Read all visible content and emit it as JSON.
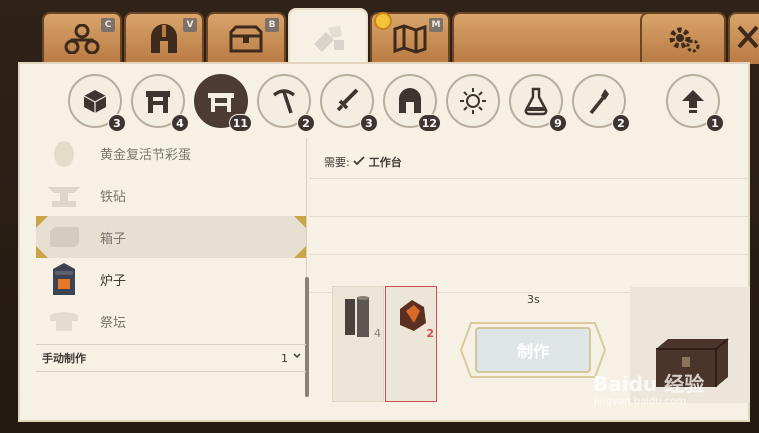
{
  "tabs": [
    {
      "key": "C",
      "icon": "skills-tree-icon"
    },
    {
      "key": "V",
      "icon": "helmet-icon"
    },
    {
      "key": "B",
      "icon": "chest-icon"
    },
    {
      "key": "",
      "icon": "crafting-icon"
    },
    {
      "key": "M",
      "icon": "map-icon"
    }
  ],
  "categories": [
    {
      "icon": "block-icon",
      "count": "3"
    },
    {
      "icon": "furnace-icon",
      "count": "4"
    },
    {
      "icon": "workbench-icon",
      "count": "11"
    },
    {
      "icon": "pickaxe-icon",
      "count": "2"
    },
    {
      "icon": "sword-icon",
      "count": "3"
    },
    {
      "icon": "helmet-icon",
      "count": "12"
    },
    {
      "icon": "sparkle-icon",
      "count": ""
    },
    {
      "icon": "potion-icon",
      "count": "9"
    },
    {
      "icon": "torch-icon",
      "count": "2"
    },
    {
      "icon": "upgrade-arrow-icon",
      "count": "1"
    }
  ],
  "recipes": [
    {
      "name": "黄金复活节彩蛋"
    },
    {
      "name": "铁砧"
    },
    {
      "name": "箱子"
    },
    {
      "name": "炉子"
    },
    {
      "name": "祭坛"
    }
  ],
  "manual": {
    "label": "手动制作",
    "qty": "1"
  },
  "detail": {
    "req_label": "需要:",
    "req_station": "工作台",
    "materials": [
      {
        "count": "4"
      },
      {
        "count": "2"
      }
    ],
    "time": "3s",
    "craft_label": "制作"
  },
  "watermark": {
    "main": "Baidu 经验",
    "sub": "jingyan.baidu.com"
  }
}
